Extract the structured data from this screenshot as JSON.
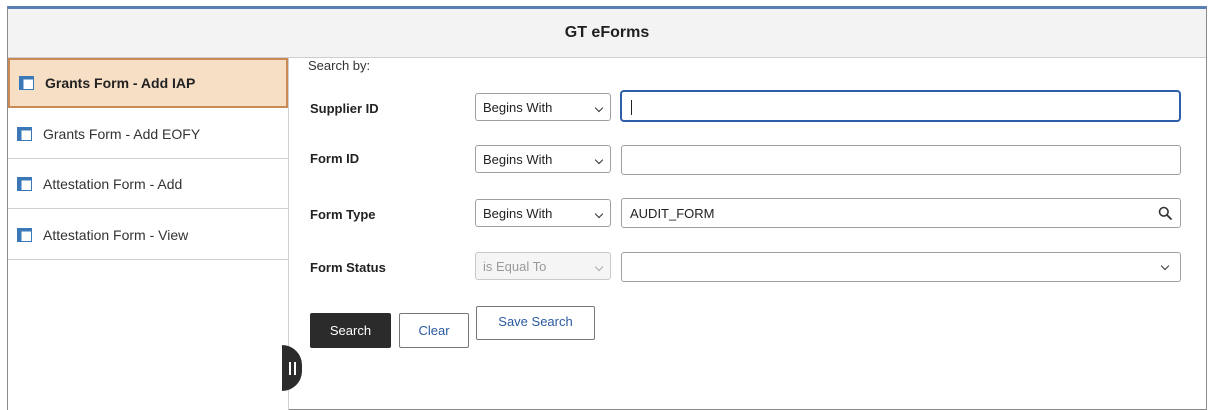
{
  "header": {
    "title": "GT eForms"
  },
  "sidebar": {
    "items": [
      {
        "label": "Grants Form - Add IAP",
        "active": true
      },
      {
        "label": "Grants Form - Add EOFY",
        "active": false
      },
      {
        "label": "Attestation Form - Add",
        "active": false
      },
      {
        "label": "Attestation Form - View",
        "active": false
      }
    ]
  },
  "search": {
    "search_by_label": "Search by:",
    "fields": [
      {
        "label": "Supplier ID",
        "operator": "Begins With",
        "value": "",
        "operator_disabled": false,
        "control": "text"
      },
      {
        "label": "Form ID",
        "operator": "Begins With",
        "value": "",
        "operator_disabled": false,
        "control": "text"
      },
      {
        "label": "Form Type",
        "operator": "Begins With",
        "value": "AUDIT_FORM",
        "operator_disabled": false,
        "control": "lookup"
      },
      {
        "label": "Form Status",
        "operator": "is Equal To",
        "value": "",
        "operator_disabled": true,
        "control": "dropdown"
      }
    ]
  },
  "buttons": {
    "search_label": "Search",
    "clear_label": "Clear",
    "save_search_label": "Save Search"
  },
  "colors": {
    "accent_border": "#5a7fb5",
    "active_item_bg": "#f7dfc5",
    "active_item_border": "#c98a55",
    "primary_button": "#2b2b2b",
    "link_blue": "#2a5a9e",
    "focus_border": "#2f5ea8"
  },
  "icons": {
    "sidebar_item": "component-icon",
    "lookup": "search-icon",
    "dropdown": "chevron-down-icon",
    "collapse": "collapse-handle-icon"
  }
}
